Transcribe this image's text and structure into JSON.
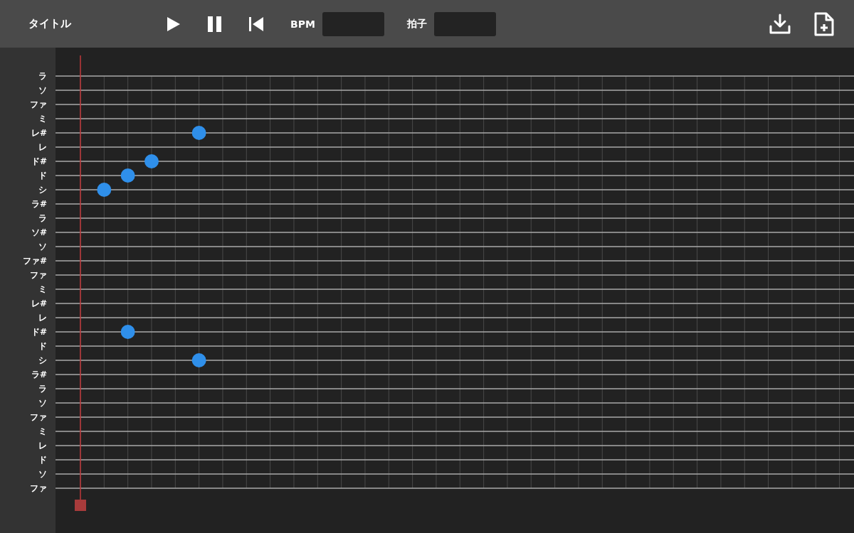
{
  "header": {
    "title": "タイトル",
    "bpm": {
      "label": "BPM"
    },
    "meter": {
      "label": "拍子"
    }
  },
  "rows": [
    {
      "label": "ラ"
    },
    {
      "label": "ソ"
    },
    {
      "label": "ファ"
    },
    {
      "label": "ミ"
    },
    {
      "label": "レ#",
      "steps": [
        false,
        false,
        false,
        false,
        false,
        true
      ]
    },
    {
      "label": "レ"
    },
    {
      "label": "ド#",
      "steps": [
        false,
        false,
        false,
        true
      ]
    },
    {
      "label": "ド",
      "steps": [
        false,
        false,
        true
      ]
    },
    {
      "label": "シ",
      "steps": [
        false,
        true
      ]
    },
    {
      "label": "ラ#"
    },
    {
      "label": "ラ"
    },
    {
      "label": "ソ#"
    },
    {
      "label": "ソ"
    },
    {
      "label": "ファ#"
    },
    {
      "label": "ファ"
    },
    {
      "label": "ミ"
    },
    {
      "label": "レ#"
    },
    {
      "label": "レ"
    },
    {
      "label": "ド#",
      "steps": [
        false,
        false,
        true
      ]
    },
    {
      "label": "ド"
    },
    {
      "label": "シ",
      "steps": [
        false,
        false,
        false,
        false,
        false,
        true
      ]
    },
    {
      "label": "ラ#"
    },
    {
      "label": "ラ"
    },
    {
      "label": "ソ"
    },
    {
      "label": "ファ"
    },
    {
      "label": "ミ"
    },
    {
      "label": "レ"
    },
    {
      "label": "ド"
    },
    {
      "label": "ソ"
    },
    {
      "label": "ファ"
    }
  ],
  "playhead": {
    "level": 0
  }
}
